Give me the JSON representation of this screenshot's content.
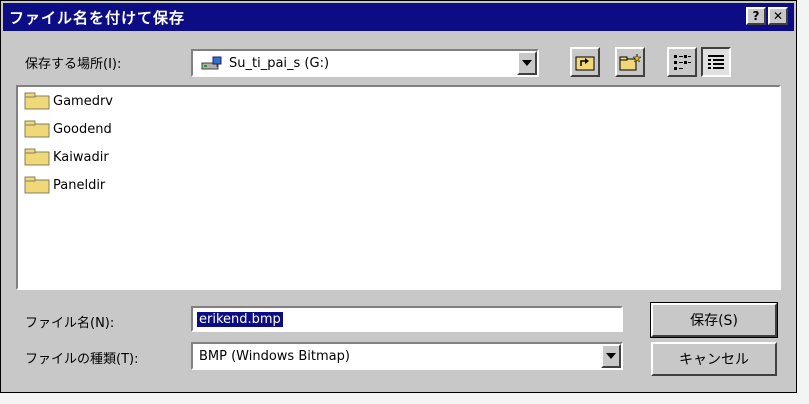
{
  "window": {
    "title": "ファイル名を付けて保存",
    "help_label": "?",
    "close_label": "✕"
  },
  "save_in": {
    "label": "保存する場所(I):",
    "value": "Su_ti_pai_s (G:)"
  },
  "files": [
    {
      "name": "Gamedrv"
    },
    {
      "name": "Goodend"
    },
    {
      "name": "Kaiwadir"
    },
    {
      "name": "Paneldir"
    }
  ],
  "filename": {
    "label": "ファイル名(N):",
    "value": "erikend.bmp"
  },
  "filetype": {
    "label": "ファイルの種類(T):",
    "value": "BMP (Windows Bitmap)"
  },
  "buttons": {
    "save": "保存(S)",
    "cancel": "キャンセル"
  },
  "colors": {
    "titlebar": "#0c0c84",
    "face": "#c8c8c8",
    "folder": "#f0d878"
  }
}
